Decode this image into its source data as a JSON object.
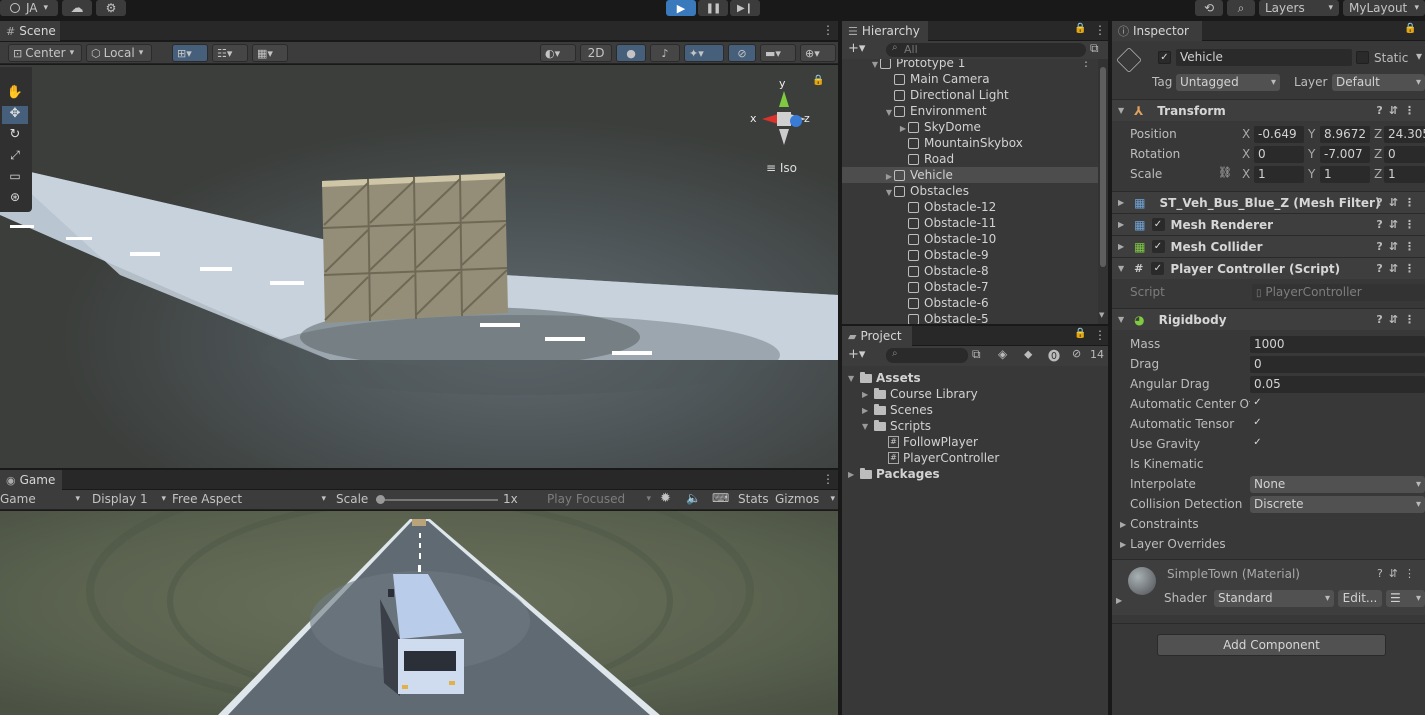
{
  "toolbar": {
    "account": "JA",
    "layers": "Layers",
    "layout": "MyLayout"
  },
  "scene": {
    "tab": "Scene",
    "pivot": "Center",
    "space": "Local",
    "mode_2d": "2D",
    "gizmo_x": "x",
    "gizmo_y": "y",
    "gizmo_z": "z",
    "projection": "Iso"
  },
  "game": {
    "tab": "Game",
    "mode": "Game",
    "display": "Display 1",
    "aspect": "Free Aspect",
    "scale_label": "Scale",
    "scale_value": "1x",
    "play_focused": "Play Focused",
    "stats": "Stats",
    "gizmos": "Gizmos"
  },
  "hierarchy": {
    "tab": "Hierarchy",
    "search_placeholder": "All",
    "items": [
      {
        "label": "Prototype 1",
        "indent": 0,
        "expand": "open"
      },
      {
        "label": "Main Camera",
        "indent": 1,
        "expand": "none"
      },
      {
        "label": "Directional Light",
        "indent": 1,
        "expand": "none"
      },
      {
        "label": "Environment",
        "indent": 1,
        "expand": "open"
      },
      {
        "label": "SkyDome",
        "indent": 2,
        "expand": "closed"
      },
      {
        "label": "MountainSkybox",
        "indent": 2,
        "expand": "none"
      },
      {
        "label": "Road",
        "indent": 2,
        "expand": "none"
      },
      {
        "label": "Vehicle",
        "indent": 1,
        "expand": "closed",
        "selected": true
      },
      {
        "label": "Obstacles",
        "indent": 1,
        "expand": "open"
      },
      {
        "label": "Obstacle-12",
        "indent": 2,
        "expand": "none"
      },
      {
        "label": "Obstacle-11",
        "indent": 2,
        "expand": "none"
      },
      {
        "label": "Obstacle-10",
        "indent": 2,
        "expand": "none"
      },
      {
        "label": "Obstacle-9",
        "indent": 2,
        "expand": "none"
      },
      {
        "label": "Obstacle-8",
        "indent": 2,
        "expand": "none"
      },
      {
        "label": "Obstacle-7",
        "indent": 2,
        "expand": "none"
      },
      {
        "label": "Obstacle-6",
        "indent": 2,
        "expand": "none"
      },
      {
        "label": "Obstacle-5",
        "indent": 2,
        "expand": "none"
      }
    ]
  },
  "project": {
    "tab": "Project",
    "hidden_count": "14",
    "items": [
      {
        "label": "Assets",
        "indent": 0,
        "type": "folder-open",
        "bold": true
      },
      {
        "label": "Course Library",
        "indent": 1,
        "type": "folder"
      },
      {
        "label": "Scenes",
        "indent": 1,
        "type": "folder"
      },
      {
        "label": "Scripts",
        "indent": 1,
        "type": "folder-open"
      },
      {
        "label": "FollowPlayer",
        "indent": 2,
        "type": "script"
      },
      {
        "label": "PlayerController",
        "indent": 2,
        "type": "script"
      },
      {
        "label": "Packages",
        "indent": 0,
        "type": "folder",
        "bold": true
      }
    ]
  },
  "inspector": {
    "tab": "Inspector",
    "object_name": "Vehicle",
    "static_label": "Static",
    "tag_label": "Tag",
    "tag_value": "Untagged",
    "layer_label": "Layer",
    "layer_value": "Default",
    "transform": {
      "title": "Transform",
      "position_label": "Position",
      "rotation_label": "Rotation",
      "scale_label": "Scale",
      "x": "X",
      "y": "Y",
      "z": "Z",
      "position": [
        "-0.649",
        "8.9672",
        "24.305"
      ],
      "rotation": [
        "0",
        "-7.007",
        "0"
      ],
      "scale": [
        "1",
        "1",
        "1"
      ]
    },
    "mesh_filter": "ST_Veh_Bus_Blue_Z (Mesh Filter)",
    "mesh_renderer": "Mesh Renderer",
    "mesh_collider": "Mesh Collider",
    "player_controller": "Player Controller (Script)",
    "script_label": "Script",
    "script_value": "PlayerController",
    "rigidbody": {
      "title": "Rigidbody",
      "mass_label": "Mass",
      "mass": "1000",
      "drag_label": "Drag",
      "drag": "0",
      "angular_drag_label": "Angular Drag",
      "angular_drag": "0.05",
      "auto_com_label": "Automatic Center Of I",
      "auto_tensor_label": "Automatic Tensor",
      "use_gravity_label": "Use Gravity",
      "is_kinematic_label": "Is Kinematic",
      "interpolate_label": "Interpolate",
      "interpolate": "None",
      "collision_label": "Collision Detection",
      "collision": "Discrete",
      "constraints_label": "Constraints",
      "layer_overrides_label": "Layer Overrides"
    },
    "material": {
      "name": "SimpleTown (Material)",
      "shader_label": "Shader",
      "shader_value": "Standard",
      "edit_label": "Edit..."
    },
    "add_component": "Add Component"
  },
  "colors": {
    "accent_blue": "#46607c",
    "play_blue": "#3a79bb",
    "road": "#c9d4de"
  }
}
